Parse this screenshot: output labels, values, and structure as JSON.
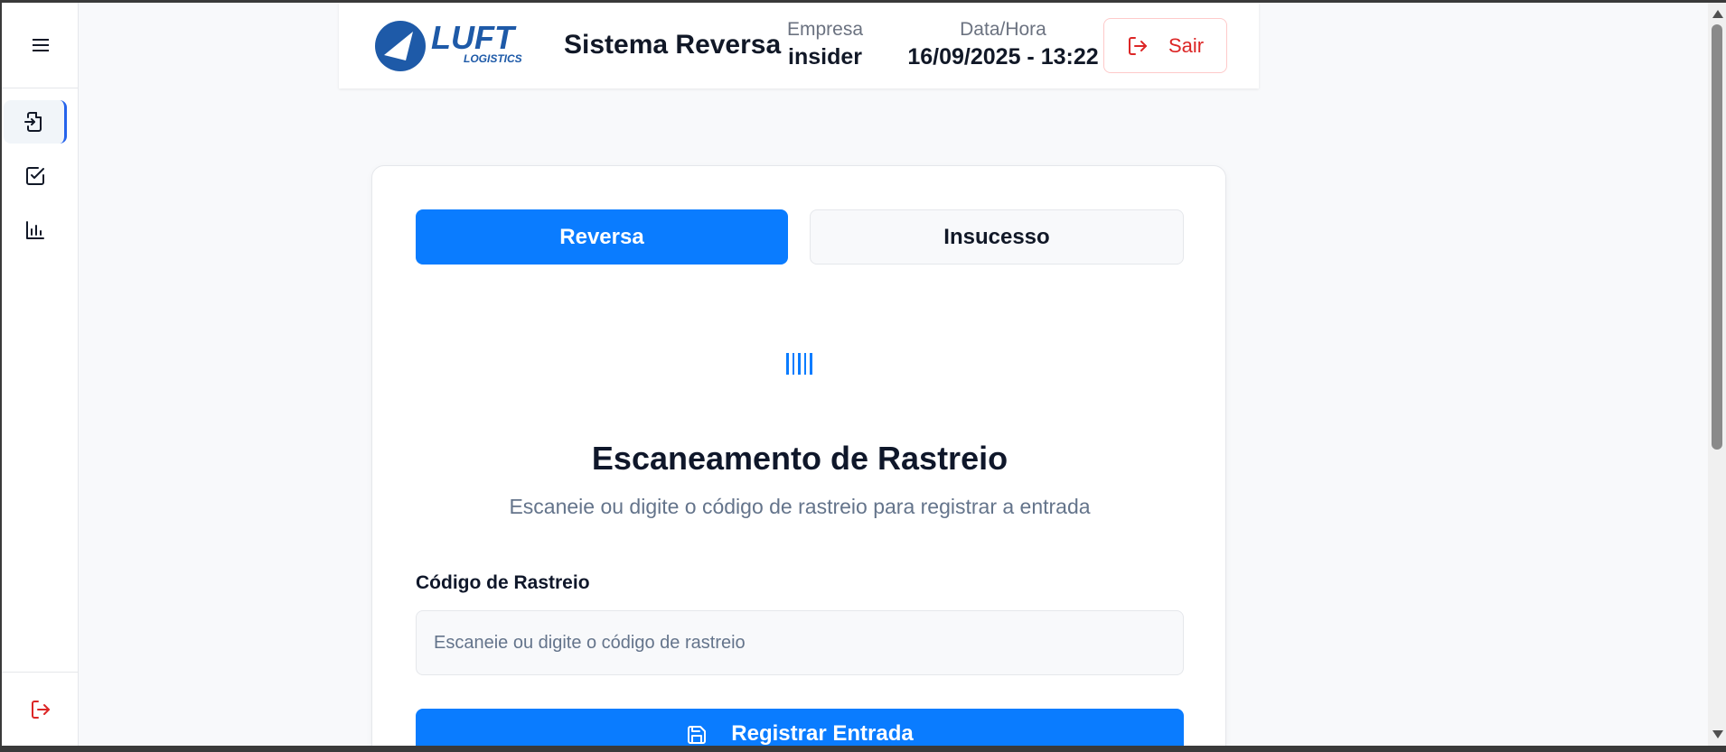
{
  "app": {
    "logo_text": "LUFT",
    "logo_sub": "LOGISTICS",
    "title": "Sistema Reversa"
  },
  "header": {
    "empresa_label": "Empresa",
    "empresa_value": "insider",
    "datahora_label": "Data/Hora",
    "datahora_value": "16/09/2025 - 13:22",
    "logout_label": "Sair"
  },
  "sidebar": {
    "items": [
      {
        "name": "entrada",
        "icon": "file-import-icon",
        "active": true
      },
      {
        "name": "checklist",
        "icon": "check-square-icon",
        "active": false
      },
      {
        "name": "relatorios",
        "icon": "bar-chart-icon",
        "active": false
      }
    ],
    "logout_icon": "logout-icon"
  },
  "tabs": [
    {
      "label": "Reversa",
      "active": true
    },
    {
      "label": "Insucesso",
      "active": false
    }
  ],
  "scan": {
    "icon": "barcode-icon",
    "title": "Escaneamento de Rastreio",
    "subtitle": "Escaneie ou digite o código de rastreio para registrar a entrada",
    "field_label": "Código de Rastreio",
    "field_value": "",
    "field_placeholder": "Escaneie ou digite o código de rastreio",
    "submit_label": "Registrar Entrada",
    "submit_icon": "save-icon"
  },
  "colors": {
    "primary": "#0a7cff",
    "danger": "#dc2626",
    "active_indicator": "#2563eb",
    "logo_blue": "#1e5aa8"
  }
}
